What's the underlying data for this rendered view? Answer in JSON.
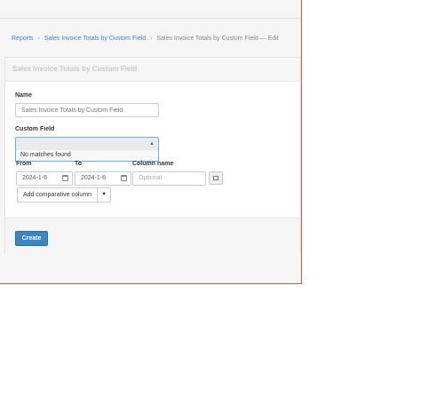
{
  "breadcrumb": {
    "items": [
      "Reports",
      "Sales Invoice Totals by Custom Field",
      "Sales Invoice Totals by Custom Field — Edit"
    ],
    "separator": "›"
  },
  "panel": {
    "title": "Sales Invoice Totals by Custom Field"
  },
  "form": {
    "name_label": "Name",
    "name_placeholder": "Sales Invoice Totals by Custom Field",
    "custom_field_label": "Custom Field",
    "custom_field_value": "",
    "no_matches": "No matches found",
    "from_label": "From",
    "to_label": "To",
    "column_name_label": "Column name",
    "from_value": "2024-1-6",
    "to_value": "2024-1-6",
    "column_name_placeholder": "Optional",
    "add_column_label": "Add comparative column",
    "create_label": "Create"
  },
  "colors": {
    "accent": "#3a87c8",
    "focus": "#66afe9",
    "frame_border": "#d9534f"
  }
}
